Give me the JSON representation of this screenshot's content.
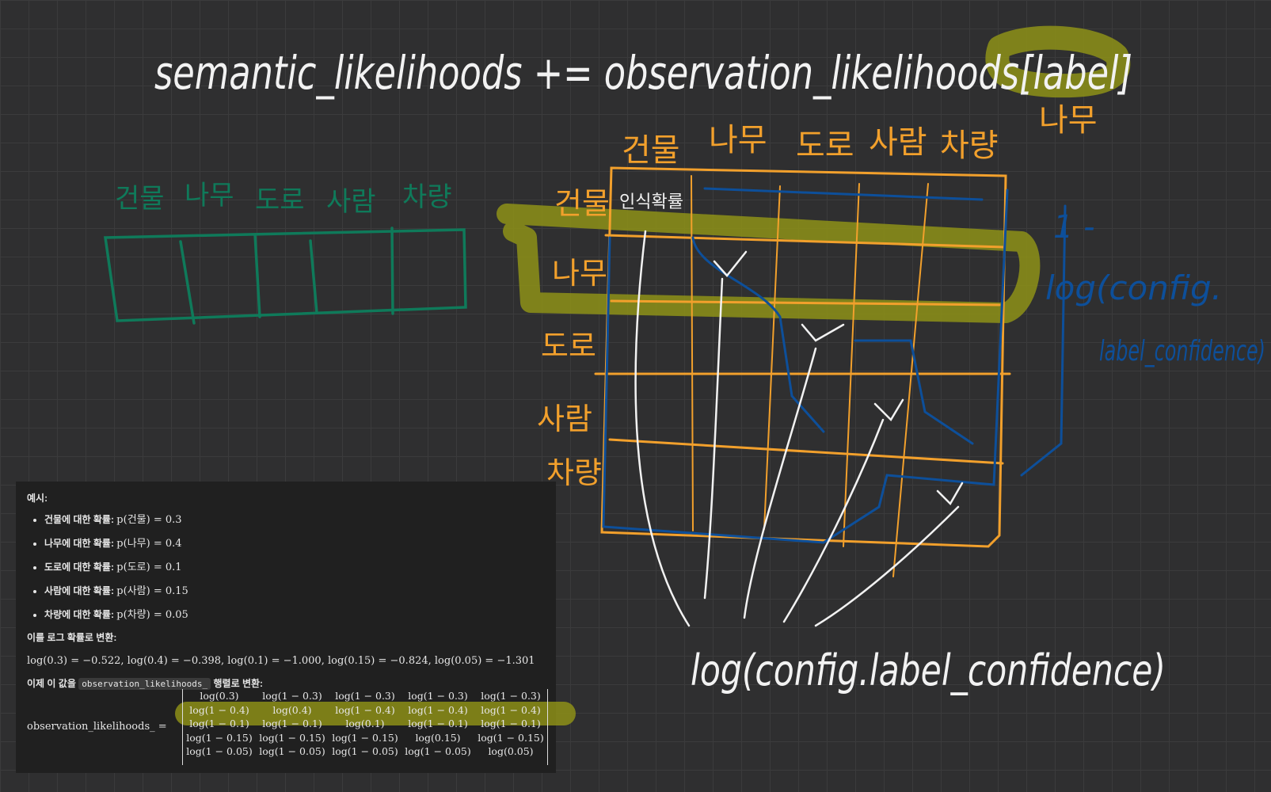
{
  "whiteboard": {
    "title_formula": "semantic_likelihoods += observation_likelihoods[label]",
    "label_note": "나무",
    "left_table_headers": [
      "건물",
      "나무",
      "도로",
      "사람",
      "차량"
    ],
    "grid_col_headers": [
      "건물",
      "나무",
      "도로",
      "사람",
      "차량"
    ],
    "grid_row_headers": [
      "건물",
      "나무",
      "도로",
      "사람",
      "차량"
    ],
    "grid_cell_note": "인식확률",
    "right_note_line1": "1 -",
    "right_note_line2": "log(config.",
    "right_note_line3": "label_confidence)",
    "bottom_formula": "log(config.label_confidence)",
    "colors": {
      "green": "#0f7a5a",
      "orange": "#f2a02c",
      "blue": "#0d4f9a",
      "white": "#f2f2f2",
      "highlight": "#8b8e18"
    }
  },
  "panel": {
    "example_title": "예시:",
    "items": [
      {
        "label": "건물에 대한 확률:",
        "math": "p(건물) = 0.3"
      },
      {
        "label": "나무에 대한 확률:",
        "math": "p(나무) = 0.4"
      },
      {
        "label": "도로에 대한 확률:",
        "math": "p(도로) = 0.1"
      },
      {
        "label": "사람에 대한 확률:",
        "math": "p(사람) = 0.15"
      },
      {
        "label": "차량에 대한 확률:",
        "math": "p(차량) = 0.05"
      }
    ],
    "conversion_title": "이를 로그 확률로 변환:",
    "log_values": "log(0.3) = −0.522,    log(0.4) = −0.398,    log(0.1) = −1.000,    log(0.15) = −0.824,    log(0.05) = −1.301",
    "matrix_intro_before": "이제 이 값을",
    "matrix_code": "observation_likelihoods_",
    "matrix_intro_after": "행렬로 변환:",
    "matrix_label": "observation_likelihoods_ =",
    "matrix": [
      [
        "log(0.3)",
        "log(1 − 0.3)",
        "log(1 − 0.3)",
        "log(1 − 0.3)",
        "log(1 − 0.3)"
      ],
      [
        "log(1 − 0.4)",
        "log(0.4)",
        "log(1 − 0.4)",
        "log(1 − 0.4)",
        "log(1 − 0.4)"
      ],
      [
        "log(1 − 0.1)",
        "log(1 − 0.1)",
        "log(0.1)",
        "log(1 − 0.1)",
        "log(1 − 0.1)"
      ],
      [
        "log(1 − 0.15)",
        "log(1 − 0.15)",
        "log(1 − 0.15)",
        "log(0.15)",
        "log(1 − 0.15)"
      ],
      [
        "log(1 − 0.05)",
        "log(1 − 0.05)",
        "log(1 − 0.05)",
        "log(1 − 0.05)",
        "log(0.05)"
      ]
    ]
  }
}
